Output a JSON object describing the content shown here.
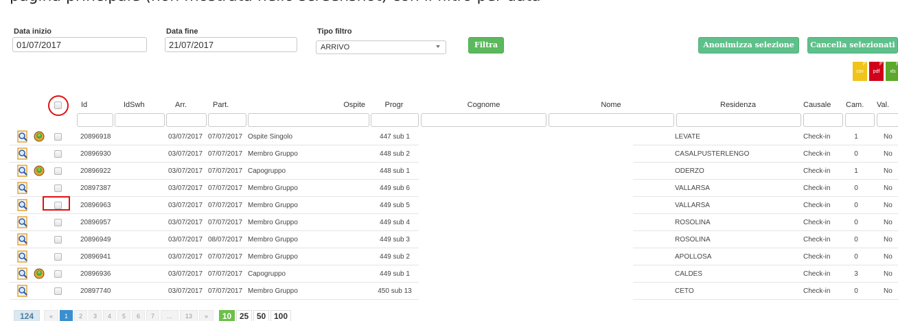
{
  "top_text": "pagina principale (non mostrata nello screenshot) con il filtro per data",
  "filters": {
    "start_label": "Data inizio",
    "start_value": "01/07/2017",
    "end_label": "Data fine",
    "end_value": "21/07/2017",
    "type_label": "Tipo filtro",
    "type_value": "ARRIVO",
    "filter_button": "Filtra"
  },
  "actions": {
    "anonymize": "Anonimizza selezione",
    "delete": "Cancella selezionati"
  },
  "exports": [
    {
      "label": "csv",
      "color": "#f0c419"
    },
    {
      "label": "pdf",
      "color": "#d0021b"
    },
    {
      "label": "xls",
      "color": "#5ba82a"
    }
  ],
  "columns": [
    "Id",
    "IdSwh",
    "Arr.",
    "Part.",
    "Ospite",
    "Progr",
    "Cognome",
    "Nome",
    "Residenza",
    "Causale",
    "Cam.",
    "Val."
  ],
  "rows": [
    {
      "globe": true,
      "id": "20896918",
      "arr": "03/07/2017",
      "part": "07/07/2017",
      "ospite": "Ospite Singolo",
      "progr": "447 sub 1",
      "residenza": "LEVATE",
      "causale": "Check-in",
      "cam": "1",
      "val": "No"
    },
    {
      "globe": false,
      "id": "20896930",
      "arr": "03/07/2017",
      "part": "07/07/2017",
      "ospite": "Membro Gruppo",
      "progr": "448 sub 2",
      "residenza": "CASALPUSTERLENGO",
      "causale": "Check-in",
      "cam": "0",
      "val": "No"
    },
    {
      "globe": true,
      "id": "20896922",
      "arr": "03/07/2017",
      "part": "07/07/2017",
      "ospite": "Capogruppo",
      "progr": "448 sub 1",
      "residenza": "ODERZO",
      "causale": "Check-in",
      "cam": "1",
      "val": "No"
    },
    {
      "globe": false,
      "id": "20897387",
      "arr": "03/07/2017",
      "part": "07/07/2017",
      "ospite": "Membro Gruppo",
      "progr": "449 sub 6",
      "residenza": "VALLARSA",
      "causale": "Check-in",
      "cam": "0",
      "val": "No"
    },
    {
      "globe": false,
      "id": "20896963",
      "arr": "03/07/2017",
      "part": "07/07/2017",
      "ospite": "Membro Gruppo",
      "progr": "449 sub 5",
      "residenza": "VALLARSA",
      "causale": "Check-in",
      "cam": "0",
      "val": "No"
    },
    {
      "globe": false,
      "id": "20896957",
      "arr": "03/07/2017",
      "part": "07/07/2017",
      "ospite": "Membro Gruppo",
      "progr": "449 sub 4",
      "residenza": "ROSOLINA",
      "causale": "Check-in",
      "cam": "0",
      "val": "No"
    },
    {
      "globe": false,
      "id": "20896949",
      "arr": "03/07/2017",
      "part": "08/07/2017",
      "ospite": "Membro Gruppo",
      "progr": "449 sub 3",
      "residenza": "ROSOLINA",
      "causale": "Check-in",
      "cam": "0",
      "val": "No"
    },
    {
      "globe": false,
      "id": "20896941",
      "arr": "03/07/2017",
      "part": "07/07/2017",
      "ospite": "Membro Gruppo",
      "progr": "449 sub 2",
      "residenza": "APOLLOSA",
      "causale": "Check-in",
      "cam": "0",
      "val": "No"
    },
    {
      "globe": true,
      "id": "20896936",
      "arr": "03/07/2017",
      "part": "07/07/2017",
      "ospite": "Capogruppo",
      "progr": "449 sub 1",
      "residenza": "CALDES",
      "causale": "Check-in",
      "cam": "3",
      "val": "No"
    },
    {
      "globe": false,
      "id": "20897740",
      "arr": "03/07/2017",
      "part": "07/07/2017",
      "ospite": "Membro Gruppo",
      "progr": "450 sub 13",
      "residenza": "CETO",
      "causale": "Check-in",
      "cam": "0",
      "val": "No"
    }
  ],
  "pagination": {
    "total": "124",
    "prev": "«",
    "pages": [
      "1",
      "2",
      "3",
      "4",
      "5",
      "6",
      "7",
      "...",
      "13"
    ],
    "active_page": "1",
    "next": "»",
    "sizes": [
      "10",
      "25",
      "50",
      "100"
    ],
    "active_size": "10"
  }
}
